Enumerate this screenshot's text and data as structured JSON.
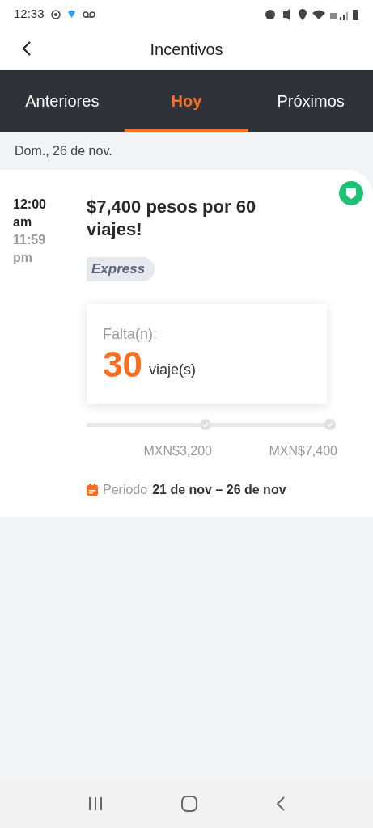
{
  "status_bar": {
    "time": "12:33"
  },
  "header": {
    "title": "Incentivos"
  },
  "tabs": [
    {
      "label": "Anteriores",
      "selected": false
    },
    {
      "label": "Hoy",
      "selected": true
    },
    {
      "label": "Próximos",
      "selected": false
    }
  ],
  "date_heading": "Dom., 26 de nov.",
  "incentive": {
    "start_time": "12:00 am",
    "end_time": "11:59 pm",
    "title": "$7,400 pesos por 60 viajes!",
    "tag": "Express",
    "remaining_label": "Falta(n):",
    "remaining_count": "30",
    "remaining_unit": "viaje(s)",
    "milestones": [
      {
        "amount": "MXN$3,200",
        "reached": false
      },
      {
        "amount": "MXN$7,400",
        "reached": false
      }
    ],
    "period_label": "Periodo",
    "period_value": "21 de nov – 26 de nov"
  }
}
